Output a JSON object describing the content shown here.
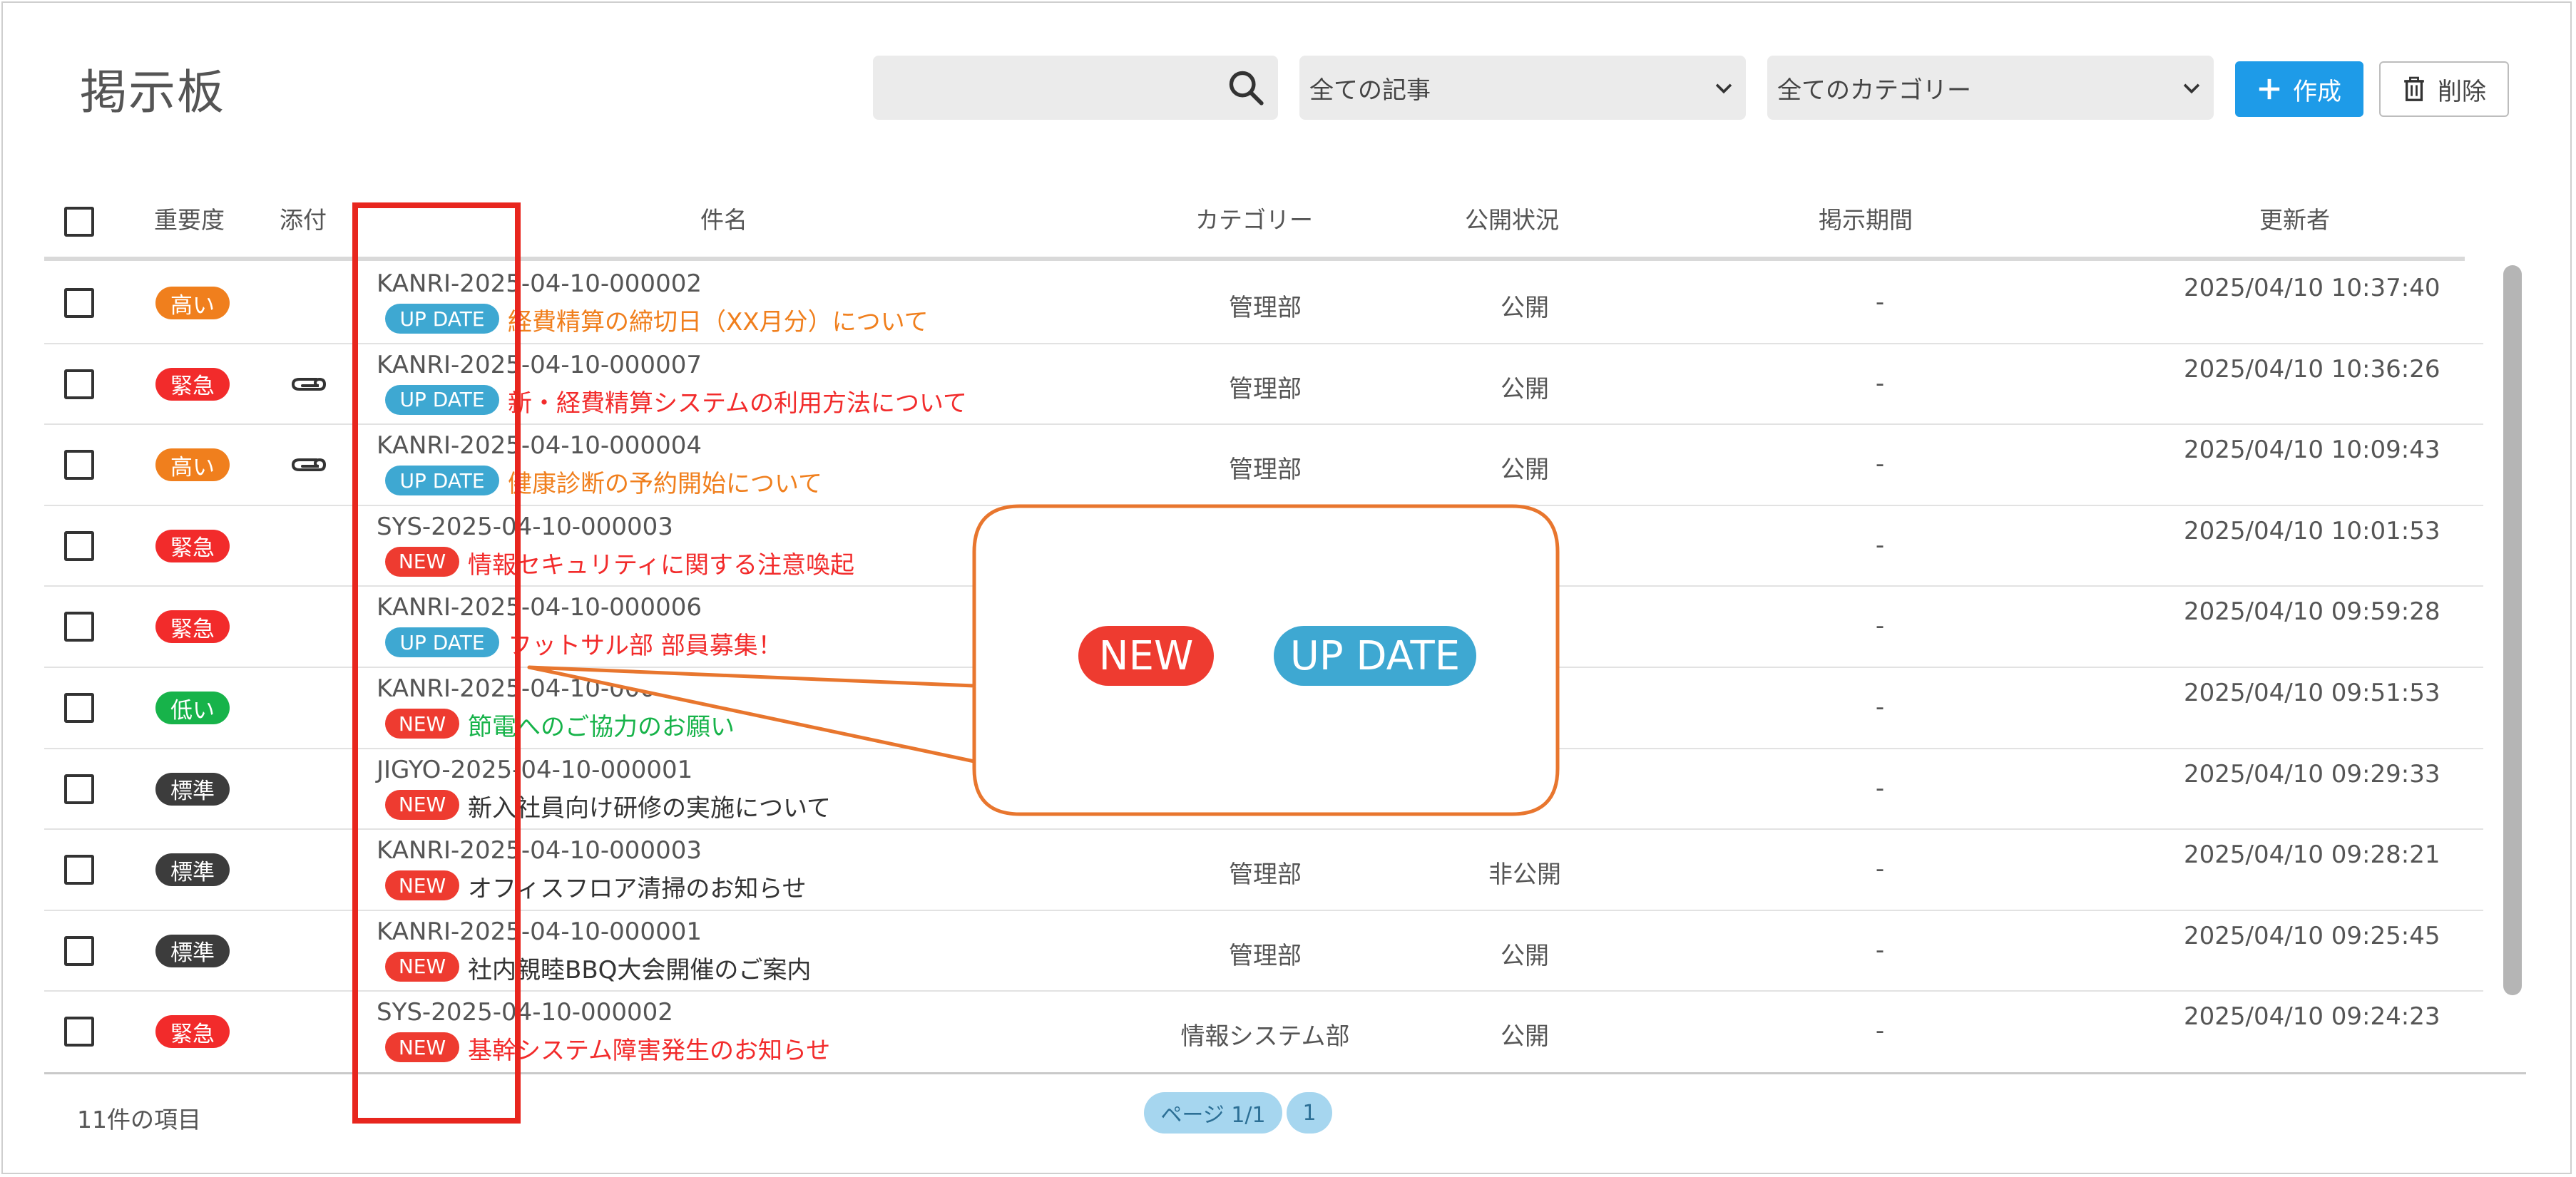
{
  "page_title": "掲示板",
  "search": {
    "placeholder": "",
    "value": ""
  },
  "filters": {
    "article_filter": "全ての記事",
    "category_filter": "全てのカテゴリー"
  },
  "toolbar": {
    "create_label": "作成",
    "delete_label": "削除"
  },
  "table": {
    "headers": {
      "importance": "重要度",
      "attachment": "添付",
      "subject": "件名",
      "category": "カテゴリー",
      "status": "公開状況",
      "period": "掲示期間",
      "updater": "更新者"
    },
    "rows": [
      {
        "importance": "高い",
        "importance_color": "#f07f1d",
        "attachment": false,
        "id": "KANRI-2025-04-10-000002",
        "tag": "UP DATE",
        "subject": "経費精算の締切日（XX月分）について",
        "subject_color": "#f07f1d",
        "category": "管理部",
        "status": "公開",
        "period": "-",
        "updated": "2025/04/10 10:37:40"
      },
      {
        "importance": "緊急",
        "importance_color": "#f22b2b",
        "attachment": true,
        "id": "KANRI-2025-04-10-000007",
        "tag": "UP DATE",
        "subject": "新・経費精算システムの利用方法について",
        "subject_color": "#f22b2b",
        "category": "管理部",
        "status": "公開",
        "period": "-",
        "updated": "2025/04/10 10:36:26"
      },
      {
        "importance": "高い",
        "importance_color": "#f07f1d",
        "attachment": true,
        "id": "KANRI-2025-04-10-000004",
        "tag": "UP DATE",
        "subject": "健康診断の予約開始について",
        "subject_color": "#f07f1d",
        "category": "管理部",
        "status": "公開",
        "period": "-",
        "updated": "2025/04/10 10:09:43"
      },
      {
        "importance": "緊急",
        "importance_color": "#f22b2b",
        "attachment": false,
        "id": "SYS-2025-04-10-000003",
        "tag": "NEW",
        "subject": "情報セキュリティに関する注意喚起",
        "subject_color": "#f22b2b",
        "category": "",
        "status": "",
        "period": "-",
        "updated": "2025/04/10 10:01:53"
      },
      {
        "importance": "緊急",
        "importance_color": "#f22b2b",
        "attachment": false,
        "id": "KANRI-2025-04-10-000006",
        "tag": "UP DATE",
        "subject": "フットサル部 部員募集！",
        "subject_color": "#f22b2b",
        "category": "",
        "status": "",
        "period": "-",
        "updated": "2025/04/10 09:59:28"
      },
      {
        "importance": "低い",
        "importance_color": "#17b34a",
        "attachment": false,
        "id": "KANRI-2025-04-10-0000",
        "tag": "NEW",
        "subject": "節電へのご協力のお願い",
        "subject_color": "#17b34a",
        "category": "",
        "status": "",
        "period": "-",
        "updated": "2025/04/10 09:51:53"
      },
      {
        "importance": "標準",
        "importance_color": "#3c3c3c",
        "attachment": false,
        "id": "JIGYO-2025-04-10-000001",
        "tag": "NEW",
        "subject": "新入社員向け研修の実施について",
        "subject_color": "#333333",
        "category": "",
        "status": "",
        "period": "-",
        "updated": "2025/04/10 09:29:33"
      },
      {
        "importance": "標準",
        "importance_color": "#3c3c3c",
        "attachment": false,
        "id": "KANRI-2025-04-10-000003",
        "tag": "NEW",
        "subject": "オフィスフロア清掃のお知らせ",
        "subject_color": "#333333",
        "category": "管理部",
        "status": "非公開",
        "period": "-",
        "updated": "2025/04/10 09:28:21"
      },
      {
        "importance": "標準",
        "importance_color": "#3c3c3c",
        "attachment": false,
        "id": "KANRI-2025-04-10-000001",
        "tag": "NEW",
        "subject": "社内親睦BBQ大会開催のご案内",
        "subject_color": "#333333",
        "category": "管理部",
        "status": "公開",
        "period": "-",
        "updated": "2025/04/10 09:25:45"
      },
      {
        "importance": "緊急",
        "importance_color": "#f22b2b",
        "attachment": false,
        "id": "SYS-2025-04-10-000002",
        "tag": "NEW",
        "subject": "基幹システム障害発生のお知らせ",
        "subject_color": "#f22b2b",
        "category": "情報システム部",
        "status": "公開",
        "period": "-",
        "updated": "2025/04/10 09:24:23"
      }
    ]
  },
  "footer": {
    "item_count": "11件の項目",
    "page_label": "ページ 1/1",
    "page_number": "1"
  },
  "callout": {
    "new_label": "NEW",
    "update_label": "UP DATE"
  },
  "colors": {
    "new_tag": "#ee3b30",
    "update_tag": "#3ea8d2",
    "accent": "#1e9be8",
    "highlight": "#e8261e",
    "callout_border": "#e8762e"
  }
}
